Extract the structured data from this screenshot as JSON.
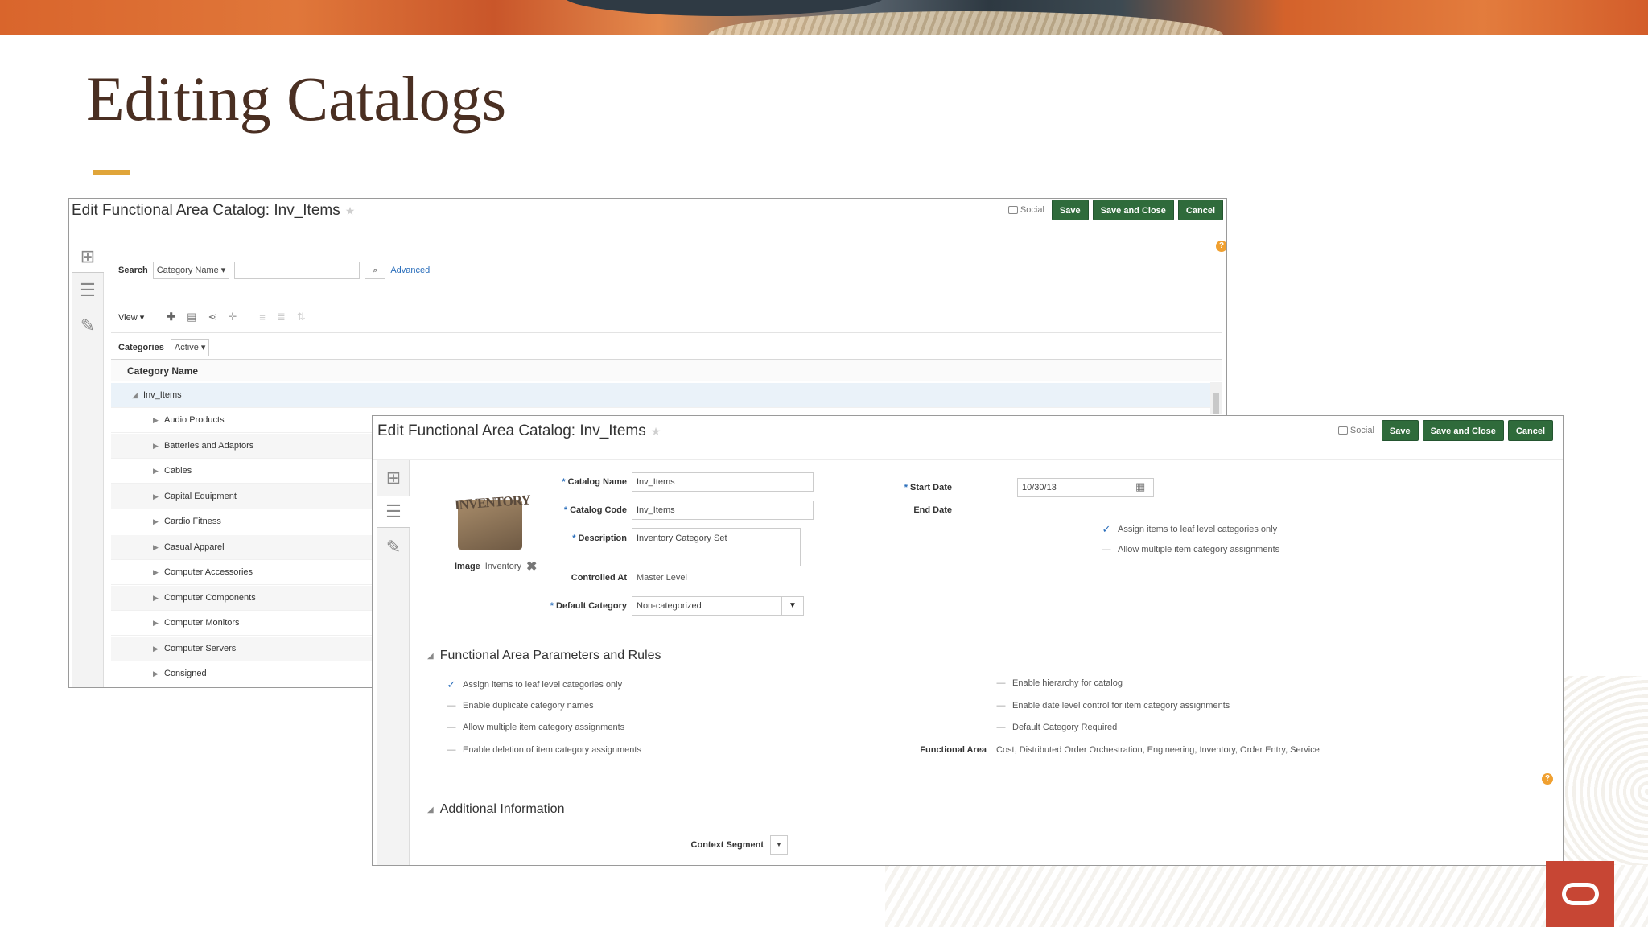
{
  "slide": {
    "title": "Editing Catalogs"
  },
  "back_window": {
    "title": "Edit Functional Area Catalog: Inv_Items",
    "social_label": "Social",
    "save": "Save",
    "save_close": "Save and Close",
    "cancel": "Cancel",
    "search_label": "Search",
    "search_field": "Category Name",
    "search_input": "",
    "advanced": "Advanced",
    "view": "View",
    "categories_label": "Categories",
    "categories_filter": "Active",
    "column_header": "Category Name",
    "root": "Inv_Items",
    "rows": [
      "Audio Products",
      "Batteries and Adaptors",
      "Cables",
      "Capital Equipment",
      "Cardio Fitness",
      "Casual Apparel",
      "Computer Accessories",
      "Computer Components",
      "Computer Monitors",
      "Computer Servers",
      "Consigned"
    ]
  },
  "front_window": {
    "title": "Edit Functional Area Catalog: Inv_Items",
    "social_label": "Social",
    "save": "Save",
    "save_close": "Save and Close",
    "cancel": "Cancel",
    "image_label": "Image",
    "image_value": "Inventory",
    "image_text": "INVENTORY",
    "catalog_name_label": "Catalog Name",
    "catalog_name": "Inv_Items",
    "catalog_code_label": "Catalog Code",
    "catalog_code": "Inv_Items",
    "description_label": "Description",
    "description": "Inventory Category Set",
    "controlled_at_label": "Controlled At",
    "controlled_at": "Master Level",
    "default_category_label": "Default Category",
    "default_category": "Non-categorized",
    "start_date_label": "Start Date",
    "start_date": "10/30/13",
    "end_date_label": "End Date",
    "top_checks": [
      {
        "label": "Assign items to leaf level categories only",
        "checked": true
      },
      {
        "label": "Allow multiple item category assignments",
        "checked": false
      }
    ],
    "section1": "Functional Area Parameters and Rules",
    "left_rules": [
      {
        "label": "Assign items to leaf level categories only",
        "checked": true
      },
      {
        "label": "Enable duplicate category names",
        "checked": false
      },
      {
        "label": "Allow multiple item category assignments",
        "checked": false
      },
      {
        "label": "Enable deletion of item category assignments",
        "checked": false
      }
    ],
    "right_rules": [
      {
        "label": "Enable hierarchy for catalog",
        "checked": false
      },
      {
        "label": "Enable date level control for item category assignments",
        "checked": false
      },
      {
        "label": "Default Category Required",
        "checked": false
      }
    ],
    "functional_area_label": "Functional Area",
    "functional_area": "Cost, Distributed Order Orchestration, Engineering, Inventory, Order Entry, Service",
    "section2": "Additional Information",
    "context_segment_label": "Context Segment"
  }
}
